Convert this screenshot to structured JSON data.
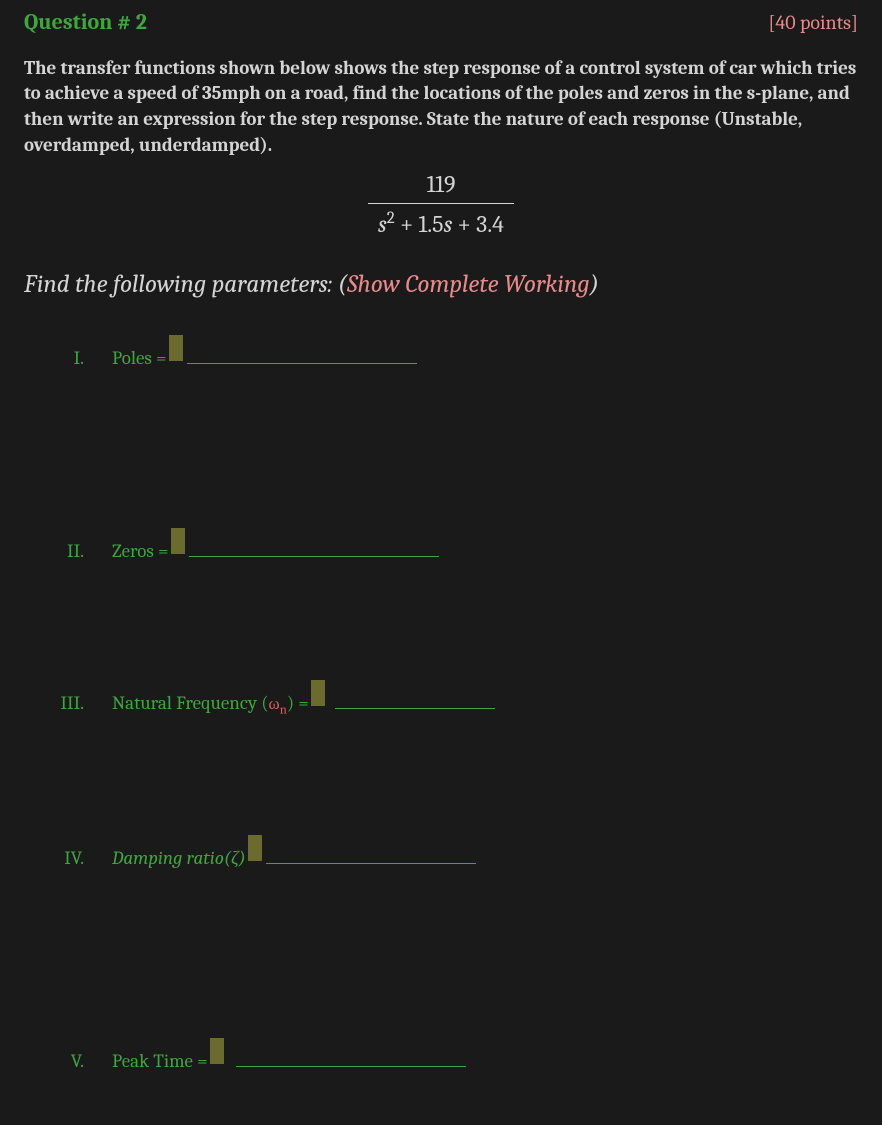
{
  "header": {
    "title": "Question # 2",
    "points": "[40 points]"
  },
  "prompt": "The transfer functions shown below shows the step response of a control system of car which tries to achieve a speed of 35mph on a road, find the locations of the poles and zeros in the s-plane, and then write an expression for the step response. State the nature of each response (Unstable, overdamped, underdamped).",
  "transfer_function": {
    "numerator": "119",
    "denominator_tex": "s² + 1.5s + 3.4"
  },
  "find_params": {
    "pre": "Find the following parameters: (",
    "highlight": "Show Complete Working",
    "post": ")"
  },
  "items": [
    {
      "num": "I.",
      "label": "Poles = "
    },
    {
      "num": "II.",
      "label": "Zeros ="
    },
    {
      "num": "III.",
      "label_pre": "Natural Frequency (",
      "omega": "ω",
      "sub": "n",
      "label_post": ") ="
    },
    {
      "num": "IV.",
      "label": "Damping ratio(ζ) "
    },
    {
      "num": "V.",
      "label": "Peak Time ="
    }
  ]
}
